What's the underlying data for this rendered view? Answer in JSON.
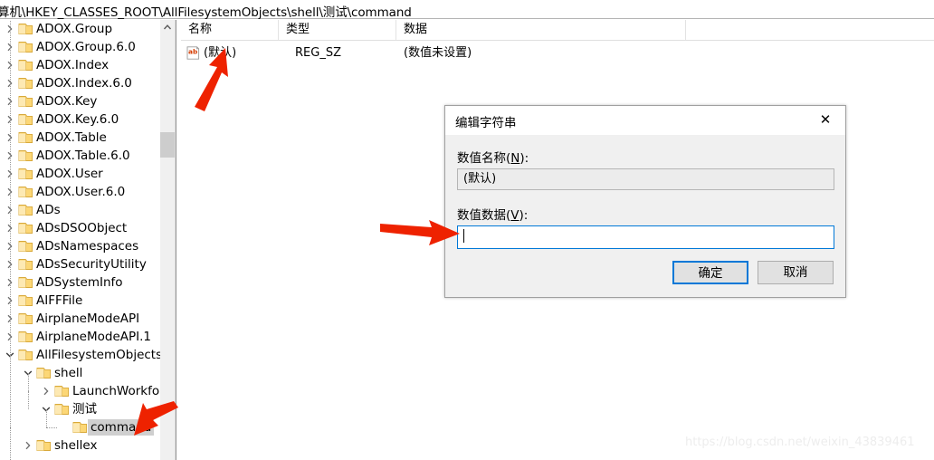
{
  "window": {
    "address_path": "算机\\HKEY_CLASSES_ROOT\\AllFilesystemObjects\\shell\\测试\\command"
  },
  "tree": {
    "items": [
      {
        "label": "ADOX.Group",
        "depth": 1,
        "expander": "collapsed"
      },
      {
        "label": "ADOX.Group.6.0",
        "depth": 1,
        "expander": "collapsed"
      },
      {
        "label": "ADOX.Index",
        "depth": 1,
        "expander": "collapsed"
      },
      {
        "label": "ADOX.Index.6.0",
        "depth": 1,
        "expander": "collapsed"
      },
      {
        "label": "ADOX.Key",
        "depth": 1,
        "expander": "collapsed"
      },
      {
        "label": "ADOX.Key.6.0",
        "depth": 1,
        "expander": "collapsed"
      },
      {
        "label": "ADOX.Table",
        "depth": 1,
        "expander": "collapsed"
      },
      {
        "label": "ADOX.Table.6.0",
        "depth": 1,
        "expander": "collapsed"
      },
      {
        "label": "ADOX.User",
        "depth": 1,
        "expander": "collapsed"
      },
      {
        "label": "ADOX.User.6.0",
        "depth": 1,
        "expander": "collapsed"
      },
      {
        "label": "ADs",
        "depth": 1,
        "expander": "collapsed"
      },
      {
        "label": "ADsDSOObject",
        "depth": 1,
        "expander": "collapsed"
      },
      {
        "label": "ADsNamespaces",
        "depth": 1,
        "expander": "collapsed"
      },
      {
        "label": "ADsSecurityUtility",
        "depth": 1,
        "expander": "collapsed"
      },
      {
        "label": "ADSystemInfo",
        "depth": 1,
        "expander": "collapsed"
      },
      {
        "label": "AIFFFile",
        "depth": 1,
        "expander": "collapsed"
      },
      {
        "label": "AirplaneModeAPI",
        "depth": 1,
        "expander": "collapsed"
      },
      {
        "label": "AirplaneModeAPI.1",
        "depth": 1,
        "expander": "collapsed"
      },
      {
        "label": "AllFilesystemObjects",
        "depth": 1,
        "expander": "expanded"
      },
      {
        "label": "shell",
        "depth": 2,
        "expander": "expanded"
      },
      {
        "label": "LaunchWorkfolder",
        "depth": 3,
        "expander": "collapsed"
      },
      {
        "label": "测试",
        "depth": 3,
        "expander": "expanded"
      },
      {
        "label": "command",
        "depth": 4,
        "expander": "none",
        "selected": true
      },
      {
        "label": "shellex",
        "depth": 2,
        "expander": "collapsed"
      }
    ]
  },
  "list": {
    "columns": [
      "名称",
      "类型",
      "数据"
    ],
    "rows": [
      {
        "name": "(默认)",
        "type": "REG_SZ",
        "data": "(数值未设置)",
        "icon": "string-value-icon"
      }
    ]
  },
  "dialog": {
    "title": "编辑字符串",
    "close_label": "✕",
    "name_label_prefix": "数值名称(",
    "name_label_key": "N",
    "name_label_suffix": "):",
    "name_value": "(默认)",
    "data_label_prefix": "数值数据(",
    "data_label_key": "V",
    "data_label_suffix": "):",
    "data_value": "",
    "ok_label": "确定",
    "cancel_label": "取消",
    "accent_color": "#0078d7"
  },
  "annotations": {
    "arrow_color": "#ee2200",
    "arrow_count": 3
  },
  "watermark": {
    "text": "https://blog.csdn.net/weixin_43839461"
  }
}
